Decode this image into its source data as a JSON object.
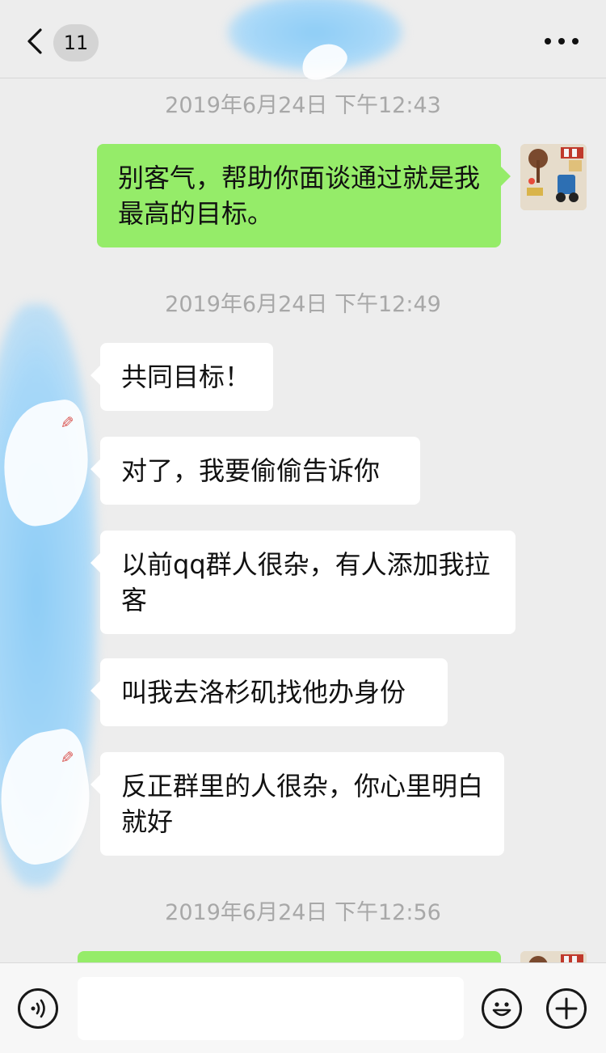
{
  "header": {
    "unread_count": "11"
  },
  "messages": {
    "t1": "2019年6月24日 下午12:43",
    "m1": "别客气，帮助你面谈通过就是我最高的目标。",
    "t2": "2019年6月24日 下午12:49",
    "m2": "共同目标！",
    "m3": "对了，我要偷偷告诉你",
    "m4": "以前qq群人很杂，有人添加我拉客",
    "m5": "叫我去洛杉矶找他办身份",
    "m6": "反正群里的人很杂，你心里明白就好",
    "t3": "2019年6月24日 下午12:56"
  },
  "input": {
    "value": ""
  },
  "icons": {
    "back": "chevron-left-icon",
    "more": "more-dots-icon",
    "voice": "voice-icon",
    "emoji": "emoji-icon",
    "plus": "plus-icon"
  },
  "colors": {
    "background": "#ededed",
    "outgoing_bubble": "#95ec69",
    "incoming_bubble": "#ffffff",
    "timestamp": "#a8a8a8"
  }
}
